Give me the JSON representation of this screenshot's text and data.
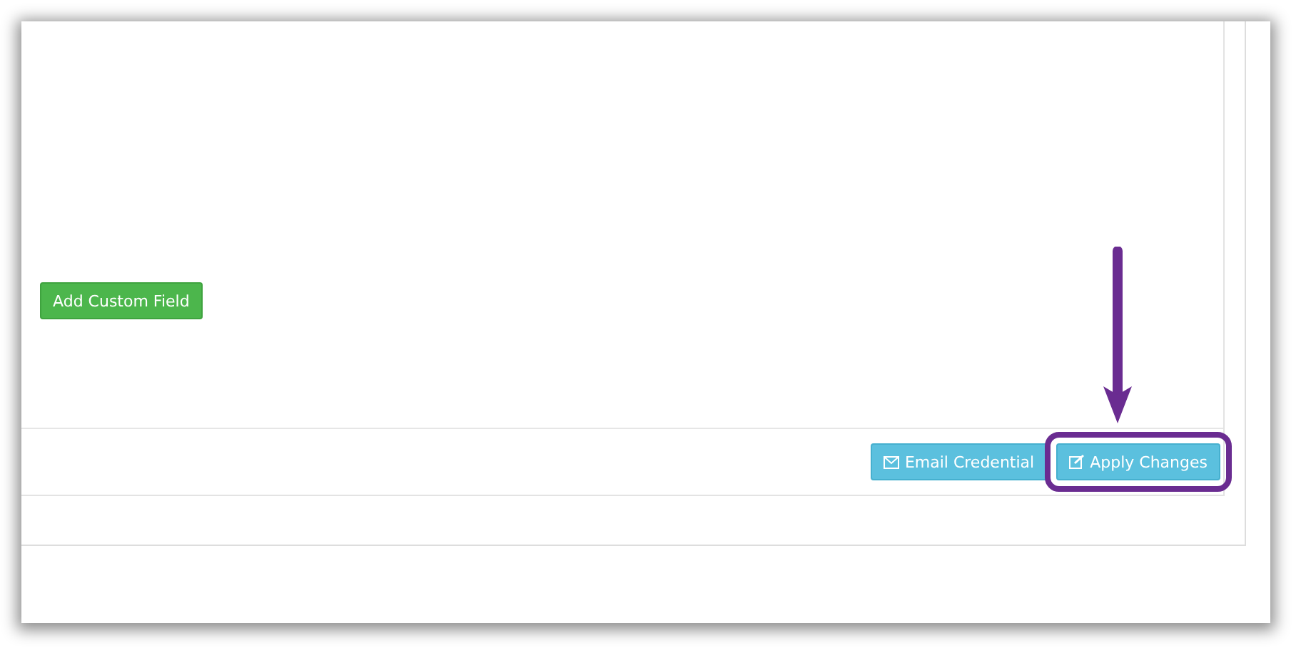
{
  "form": {
    "add_button": "Add Custom Field"
  },
  "footer": {
    "buttons": [
      {
        "label": "Email Credential",
        "kind": "email",
        "highlighted": false
      },
      {
        "label": "Apply Changes",
        "kind": "edit",
        "highlighted": true
      }
    ]
  }
}
